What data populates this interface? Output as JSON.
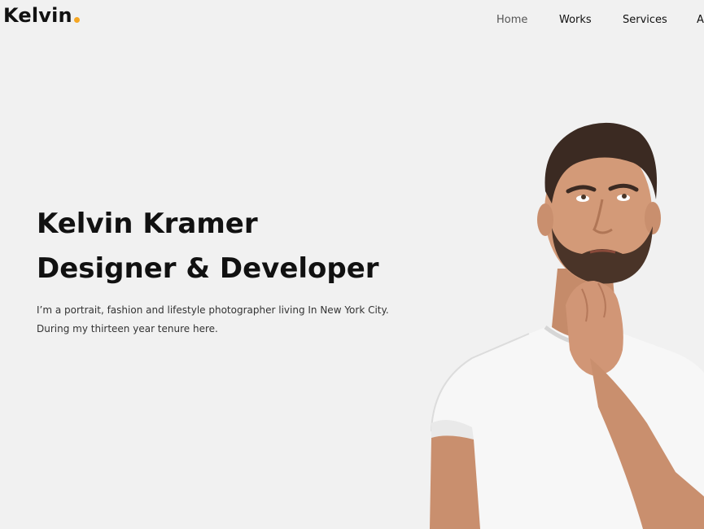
{
  "header": {
    "logo_text": "Kelvin",
    "logo_dot_color": "#f5a623",
    "nav": {
      "home": "Home",
      "works": "Works",
      "services": "Services",
      "about": "A"
    }
  },
  "hero": {
    "title_line1": "Kelvin Kramer",
    "title_line2": "Designer & Developer",
    "desc_line1": "I’m a portrait, fashion and lifestyle photographer living In New York City.",
    "desc_line2": "During my thirteen year tenure here."
  },
  "colors": {
    "background": "#f1f1f1",
    "accent": "#f5a623",
    "text": "#111111"
  }
}
